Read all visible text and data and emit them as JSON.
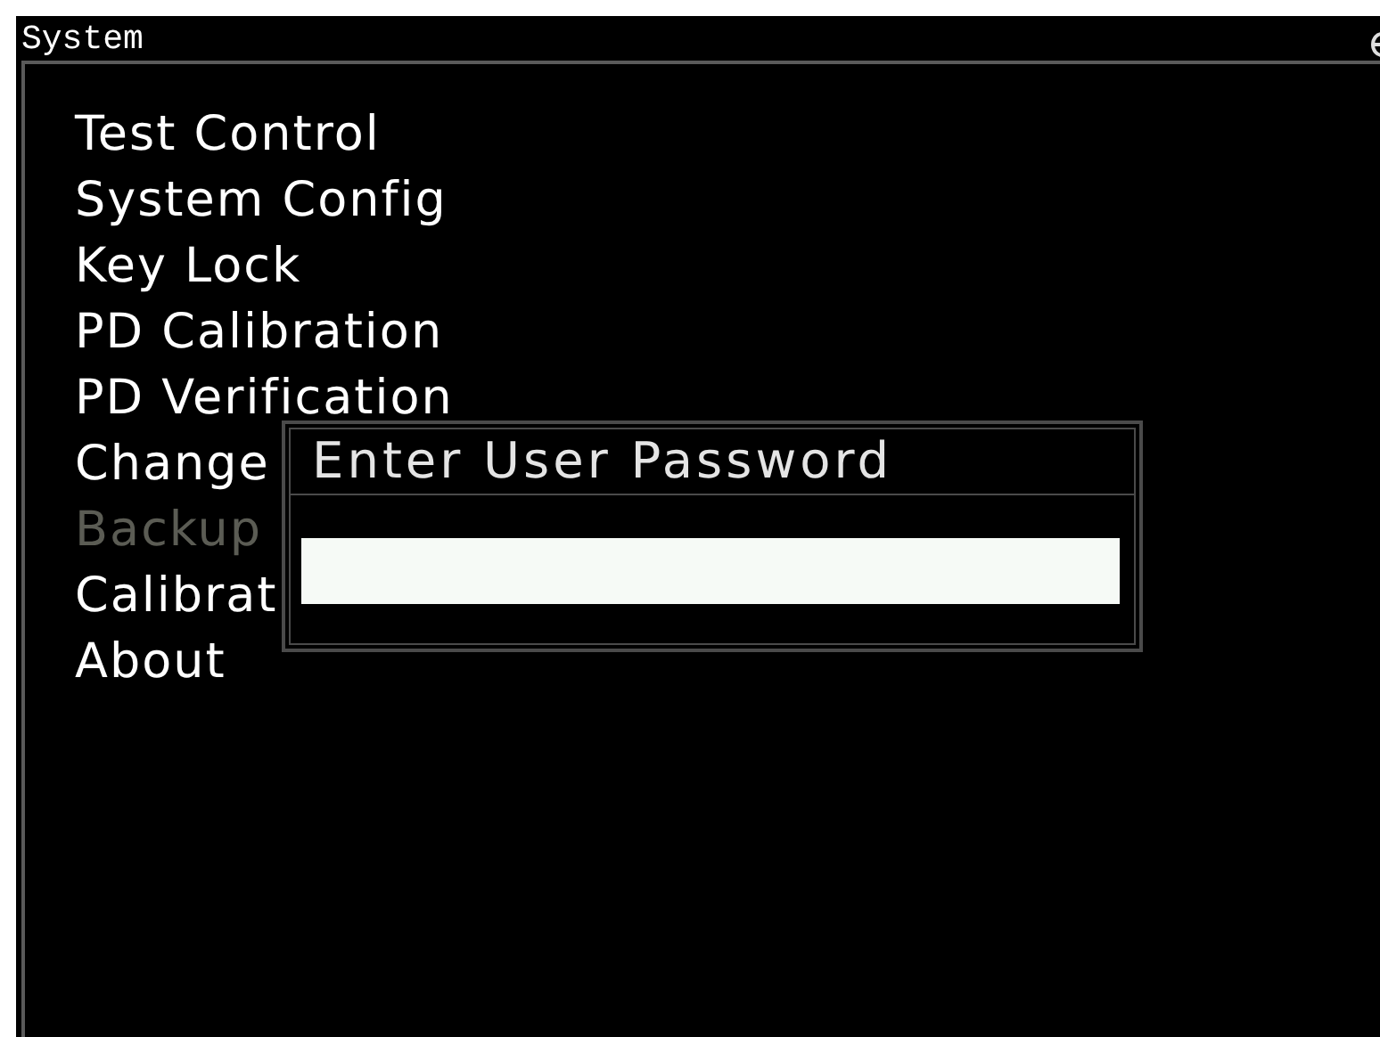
{
  "window": {
    "title": "System"
  },
  "menu": [
    {
      "label": "Test Control",
      "disabled": false
    },
    {
      "label": "System Config",
      "disabled": false
    },
    {
      "label": "Key Lock",
      "disabled": false
    },
    {
      "label": "PD Calibration",
      "disabled": false
    },
    {
      "label": "PD Verification",
      "disabled": false
    },
    {
      "label": "Change",
      "disabled": false
    },
    {
      "label": "Backup",
      "disabled": true
    },
    {
      "label": "Calibrat",
      "disabled": false
    },
    {
      "label": "About",
      "disabled": false
    }
  ],
  "dialog": {
    "title": "Enter User Password",
    "field": {
      "kind": "password"
    }
  }
}
